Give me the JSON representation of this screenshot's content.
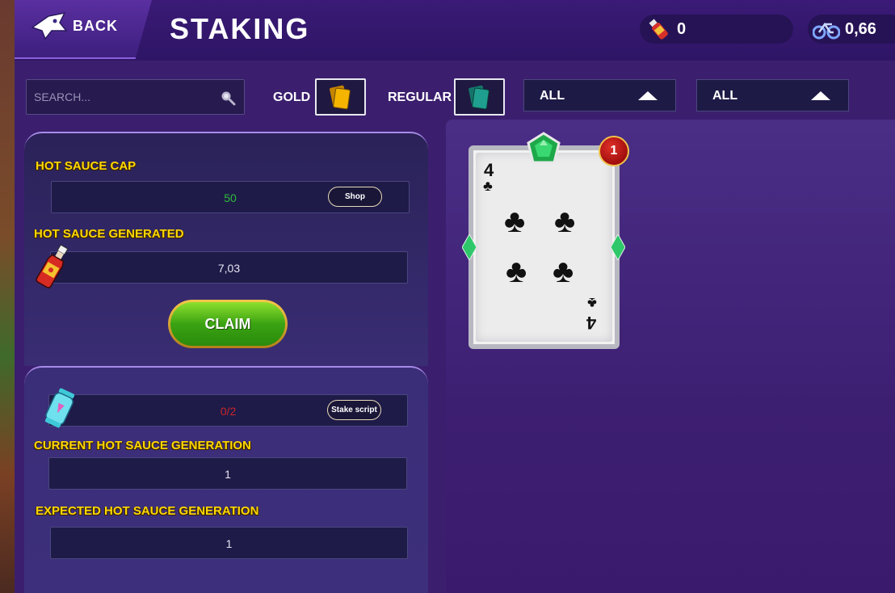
{
  "header": {
    "back_label": "BACK",
    "title": "STAKING",
    "currencies": [
      {
        "icon": "hot-sauce-bottle-icon",
        "value": "0"
      },
      {
        "icon": "bike-icon",
        "value": "0,66"
      }
    ]
  },
  "filters": {
    "search_placeholder": "SEARCH...",
    "gold_label": "GOLD",
    "regular_label": "REGULAR",
    "dropdown_1": "ALL",
    "dropdown_2": "ALL",
    "gold_color": "#f5b400",
    "regular_color": "#1f9f8f"
  },
  "staking": {
    "cap_label": "HOT SAUCE CAP",
    "cap_value": "50",
    "cap_value_color": "#2ebd3a",
    "shop_label": "Shop",
    "generated_label": "HOT SAUCE GENERATED",
    "generated_value": "7,03",
    "claim_label": "CLAIM",
    "script_value": "0/2",
    "script_value_color": "#c9252a",
    "stake_script_label": "Stake script",
    "current_label": "CURRENT HOT SAUCE GENERATION",
    "current_value": "1",
    "expected_label": "EXPECTED HOT SAUCE GENERATION",
    "expected_value": "1"
  },
  "card": {
    "rank": "4",
    "suit": "♣",
    "count": "1",
    "gem_color": "#1ea84a"
  }
}
